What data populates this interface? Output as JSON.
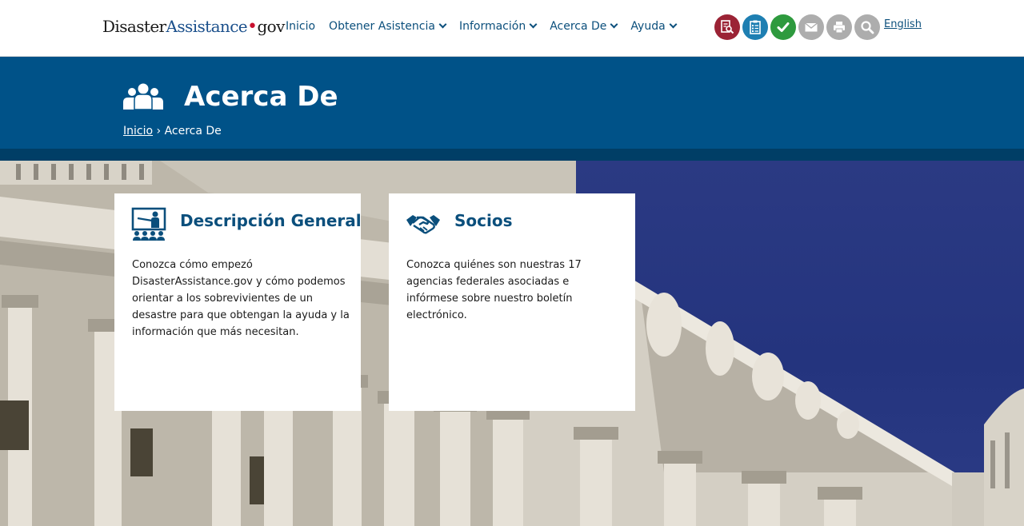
{
  "header": {
    "logo": {
      "part1": "Disaster",
      "part2": "Assistance",
      "part3": "gov"
    },
    "nav": [
      {
        "label": "Inicio",
        "has_dropdown": false
      },
      {
        "label": "Obtener Asistencia",
        "has_dropdown": true
      },
      {
        "label": "Información",
        "has_dropdown": true
      },
      {
        "label": "Acerca De",
        "has_dropdown": true
      },
      {
        "label": "Ayuda",
        "has_dropdown": true
      }
    ],
    "tools": [
      {
        "icon": "document-search-icon",
        "color": "#9b2335"
      },
      {
        "icon": "checklist-icon",
        "color": "#1e7fb2"
      },
      {
        "icon": "checkmark-icon",
        "color": "#2e9a3e"
      },
      {
        "icon": "envelope-icon",
        "color": "#adadad"
      },
      {
        "icon": "printer-icon",
        "color": "#adadad"
      },
      {
        "icon": "search-icon",
        "color": "#adadad"
      }
    ],
    "language_link": "English"
  },
  "banner": {
    "icon": "people-icon",
    "title": "Acerca De",
    "breadcrumb": {
      "home": "Inicio",
      "separator": "›",
      "current": "Acerca De"
    }
  },
  "cards": [
    {
      "icon": "presentation-icon",
      "title": "Descripción General",
      "text": "Conozca cómo empezó DisasterAssistance.gov y cómo podemos orientar a los sobrevivientes de un desastre para que obtengan la ayuda y la información que más necesitan."
    },
    {
      "icon": "handshake-icon",
      "title": "Socios",
      "text": "Conozca quiénes son nuestras 17 agencias federales asociadas e infórmese sobre nuestro boletín electrónico."
    }
  ],
  "colors": {
    "brand_blue": "#005288",
    "banner_strip": "#003e66",
    "link_blue": "#0b4f7c",
    "logo_red": "#c8102e"
  }
}
